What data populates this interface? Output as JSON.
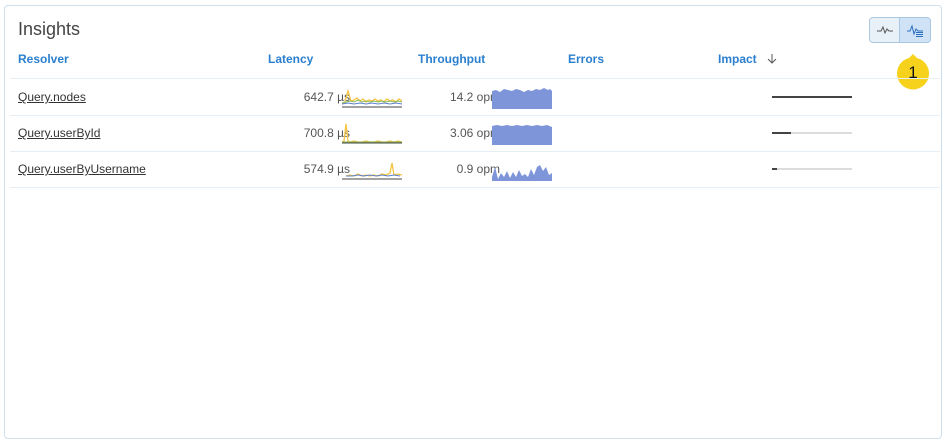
{
  "panel": {
    "title": "Insights",
    "view_toggle": {
      "left_icon": "sparkline-icon",
      "right_icon": "bar-sparkline-icon",
      "selected": "right"
    },
    "callout_number": "1"
  },
  "columns": {
    "resolver": "Resolver",
    "latency": "Latency",
    "throughput": "Throughput",
    "errors": "Errors",
    "impact": "Impact",
    "impact_sort_icon": "arrow-down-icon"
  },
  "rows": [
    {
      "resolver": "Query.nodes",
      "latency": "642.7 µs",
      "throughput": "14.2 opm",
      "impact_fraction": 1.0
    },
    {
      "resolver": "Query.userById",
      "latency": "700.8 µs",
      "throughput": "3.06 opm",
      "impact_fraction": 0.24
    },
    {
      "resolver": "Query.userByUsername",
      "latency": "574.9 µs",
      "throughput": "0.9 opm",
      "impact_fraction": 0.06
    }
  ],
  "colors": {
    "accent": "#2a7fcf",
    "latency_line_a": "#f4c542",
    "latency_line_b": "#8bb85a",
    "latency_line_c": "#5b7fcf",
    "throughput_fill": "#7f95d9",
    "callout": "#f7d21d"
  }
}
